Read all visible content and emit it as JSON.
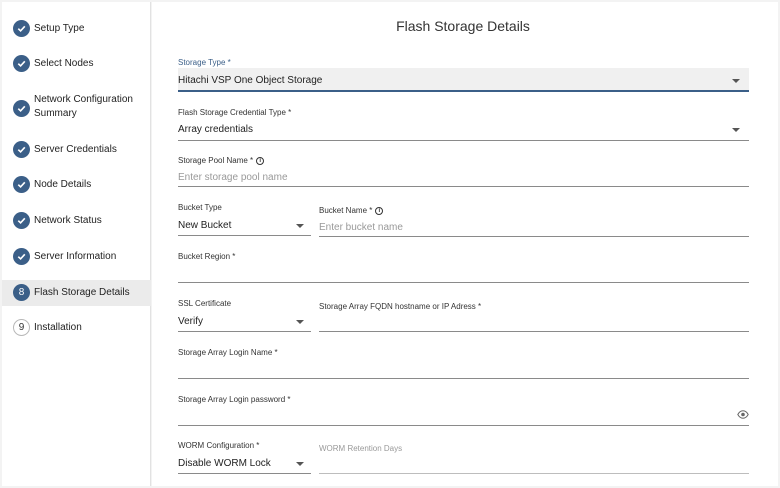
{
  "sidebar": {
    "steps": [
      {
        "label": "Setup Type",
        "status": "done"
      },
      {
        "label": "Select Nodes",
        "status": "done"
      },
      {
        "label": "Network Configuration Summary",
        "status": "done"
      },
      {
        "label": "Server Credentials",
        "status": "done"
      },
      {
        "label": "Node Details",
        "status": "done"
      },
      {
        "label": "Network Status",
        "status": "done"
      },
      {
        "label": "Server Information",
        "status": "done"
      },
      {
        "label": "Flash Storage Details",
        "status": "current",
        "number": "8"
      },
      {
        "label": "Installation",
        "status": "todo",
        "number": "9"
      }
    ]
  },
  "main": {
    "title": "Flash Storage Details",
    "storage_type": {
      "label": "Storage Type *",
      "value": "Hitachi VSP One Object Storage"
    },
    "credential_type": {
      "label": "Flash Storage Credential Type *",
      "value": "Array credentials"
    },
    "pool_name": {
      "label": "Storage Pool Name *",
      "placeholder": "Enter storage pool name"
    },
    "bucket_type": {
      "label": "Bucket Type",
      "value": "New Bucket"
    },
    "bucket_name": {
      "label": "Bucket Name *",
      "placeholder": "Enter bucket name"
    },
    "bucket_region": {
      "label": "Bucket Region *",
      "value": ""
    },
    "ssl_certificate": {
      "label": "SSL Certificate",
      "value": "Verify"
    },
    "fqdn": {
      "label": "Storage Array FQDN hostname or IP Adress *",
      "value": ""
    },
    "login_name": {
      "label": "Storage Array Login Name *",
      "value": ""
    },
    "login_password": {
      "label": "Storage Array Login password *",
      "value": ""
    },
    "worm_config": {
      "label": "WORM Configuration *",
      "value": "Disable WORM Lock"
    },
    "worm_days": {
      "label": "WORM Retention Days",
      "value": ""
    }
  },
  "colors": {
    "accent": "#3b5f88",
    "active_step_bg": "#ebebeb",
    "filled_field_bg": "#f0f0f0"
  },
  "icons": {
    "done_step": "check-icon",
    "info": "info-icon",
    "password_toggle": "eye-icon",
    "dropdown": "caret-down-icon"
  }
}
